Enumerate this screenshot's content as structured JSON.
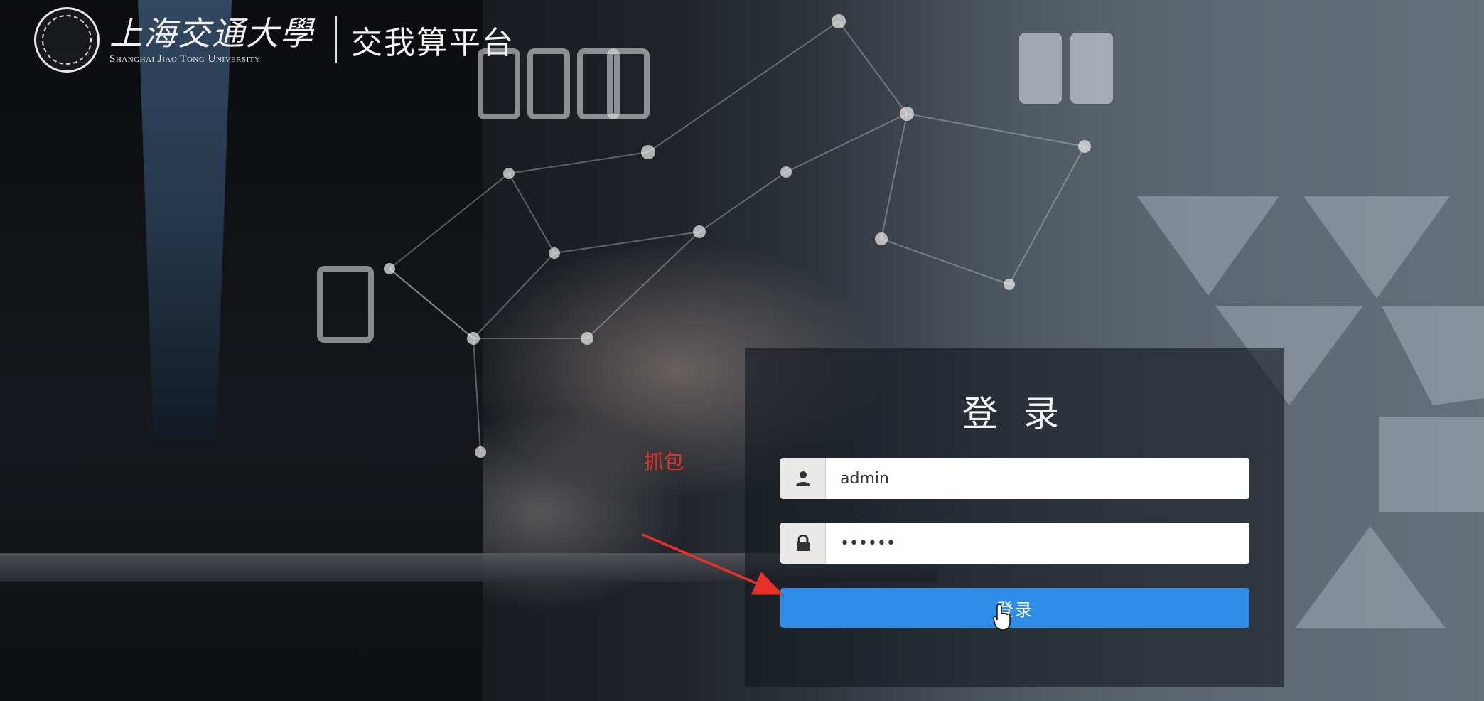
{
  "header": {
    "university_cn": "上海交通大學",
    "university_en": "Shanghai Jiao Tong University",
    "platform_title": "交我算平台"
  },
  "login": {
    "title": "登 录",
    "username_value": "admin",
    "password_value": "••••••",
    "submit_label": "登录"
  },
  "annotation": {
    "text": "抓包",
    "color": "#e8302b"
  },
  "colors": {
    "primary_button": "#2e8be6",
    "panel_bg": "rgba(20,24,30,0.62)"
  },
  "icons": {
    "username_field": "user-icon",
    "password_field": "lock-icon",
    "pointer": "hand-cursor-icon",
    "logo": "university-seal"
  }
}
